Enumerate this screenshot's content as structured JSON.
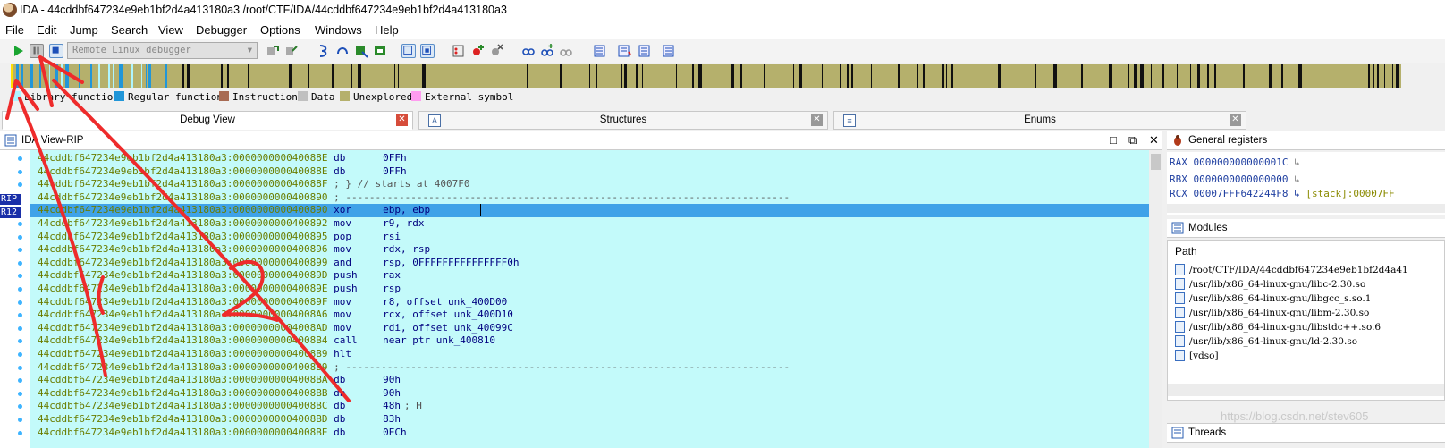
{
  "window": {
    "title": "IDA - 44cddbf647234e9eb1bf2d4a413180a3 /root/CTF/IDA/44cddbf647234e9eb1bf2d4a413180a3"
  },
  "menu": [
    "File",
    "Edit",
    "Jump",
    "Search",
    "View",
    "Debugger",
    "Options",
    "Windows",
    "Help"
  ],
  "toolbar": {
    "debugger_select": "Remote Linux debugger",
    "icons": [
      "start-process-icon",
      "pause-process-icon",
      "terminate-process-icon"
    ]
  },
  "legend": [
    {
      "label": "Library function",
      "color": "#aef5ff"
    },
    {
      "label": "Regular function",
      "color": "#2196d8"
    },
    {
      "label": "Instruction",
      "color": "#a86b53"
    },
    {
      "label": "Data",
      "color": "#c0c0c0"
    },
    {
      "label": "Unexplored",
      "color": "#b5b06c"
    },
    {
      "label": "External symbol",
      "color": "#ff9cf0"
    }
  ],
  "tabs": [
    {
      "label": "Debug View",
      "active": true
    },
    {
      "label": "Structures",
      "active": false
    },
    {
      "label": "Enums",
      "active": false
    }
  ],
  "ida_view": {
    "title": "IDA View-RIP",
    "reg_labels": [
      "RIP",
      "R12"
    ],
    "lines": [
      {
        "addr": "44cddbf647234e9eb1bf2d4a413180a3:000000000040088E",
        "mnem": "db",
        "ops": "0FFh",
        "comment": ""
      },
      {
        "addr": "44cddbf647234e9eb1bf2d4a413180a3:000000000040088E",
        "mnem": "db",
        "ops": "0FFh",
        "comment": ""
      },
      {
        "addr": "44cddbf647234e9eb1bf2d4a413180a3:000000000040088F",
        "mnem": "",
        "ops": "",
        "comment": "; } // starts at 4007F0"
      },
      {
        "addr": "44cddbf647234e9eb1bf2d4a413180a3:0000000000400890",
        "mnem": "",
        "ops": "",
        "comment": "; ---------------------------------------------------------------------------"
      },
      {
        "addr": "44cddbf647234e9eb1bf2d4a413180a3:0000000000400890",
        "mnem": "xor",
        "ops": "ebp, ebp",
        "comment": ""
      },
      {
        "addr": "44cddbf647234e9eb1bf2d4a413180a3:0000000000400892",
        "mnem": "mov",
        "ops": "r9, rdx",
        "comment": ""
      },
      {
        "addr": "44cddbf647234e9eb1bf2d4a413180a3:0000000000400895",
        "mnem": "pop",
        "ops": "rsi",
        "comment": ""
      },
      {
        "addr": "44cddbf647234e9eb1bf2d4a413180a3:0000000000400896",
        "mnem": "mov",
        "ops": "rdx, rsp",
        "comment": ""
      },
      {
        "addr": "44cddbf647234e9eb1bf2d4a413180a3:0000000000400899",
        "mnem": "and",
        "ops": "rsp, 0FFFFFFFFFFFFFFF0h",
        "comment": ""
      },
      {
        "addr": "44cddbf647234e9eb1bf2d4a413180a3:000000000040089D",
        "mnem": "push",
        "ops": "rax",
        "comment": ""
      },
      {
        "addr": "44cddbf647234e9eb1bf2d4a413180a3:000000000040089E",
        "mnem": "push",
        "ops": "rsp",
        "comment": ""
      },
      {
        "addr": "44cddbf647234e9eb1bf2d4a413180a3:000000000040089F",
        "mnem": "mov",
        "ops": "r8, offset unk_400D00",
        "comment": ""
      },
      {
        "addr": "44cddbf647234e9eb1bf2d4a413180a3:00000000004008A6",
        "mnem": "mov",
        "ops": "rcx, offset unk_400D10",
        "comment": ""
      },
      {
        "addr": "44cddbf647234e9eb1bf2d4a413180a3:00000000004008AD",
        "mnem": "mov",
        "ops": "rdi, offset unk_40099C",
        "comment": ""
      },
      {
        "addr": "44cddbf647234e9eb1bf2d4a413180a3:00000000004008B4",
        "mnem": "call",
        "ops": "near ptr unk_400810",
        "comment": ""
      },
      {
        "addr": "44cddbf647234e9eb1bf2d4a413180a3:00000000004008B9",
        "mnem": "hlt",
        "ops": "",
        "comment": ""
      },
      {
        "addr": "44cddbf647234e9eb1bf2d4a413180a3:00000000004008B9",
        "mnem": "",
        "ops": "",
        "comment": "; ---------------------------------------------------------------------------"
      },
      {
        "addr": "44cddbf647234e9eb1bf2d4a413180a3:00000000004008BA",
        "mnem": "db",
        "ops": "90h",
        "comment": ""
      },
      {
        "addr": "44cddbf647234e9eb1bf2d4a413180a3:00000000004008BB",
        "mnem": "db",
        "ops": "90h",
        "comment": ""
      },
      {
        "addr": "44cddbf647234e9eb1bf2d4a413180a3:00000000004008BC",
        "mnem": "db",
        "ops": "48h",
        "comment": "; H"
      },
      {
        "addr": "44cddbf647234e9eb1bf2d4a413180a3:00000000004008BD",
        "mnem": "db",
        "ops": "83h",
        "comment": ""
      },
      {
        "addr": "44cddbf647234e9eb1bf2d4a413180a3:00000000004008BE",
        "mnem": "db",
        "ops": "0ECh",
        "comment": ""
      }
    ]
  },
  "registers": {
    "title": "General registers",
    "items": [
      {
        "name": "RAX",
        "value": "000000000000001C",
        "note": ""
      },
      {
        "name": "RBX",
        "value": "0000000000000000",
        "note": ""
      },
      {
        "name": "RCX",
        "value": "00007FFF642244F8",
        "note": "[stack]:00007FF"
      }
    ]
  },
  "modules": {
    "title": "Modules",
    "column": "Path",
    "items": [
      "/root/CTF/IDA/44cddbf647234e9eb1bf2d4a41",
      "/usr/lib/x86_64-linux-gnu/libc-2.30.so",
      "/usr/lib/x86_64-linux-gnu/libgcc_s.so.1",
      "/usr/lib/x86_64-linux-gnu/libm-2.30.so",
      "/usr/lib/x86_64-linux-gnu/libstdc++.so.6",
      "/usr/lib/x86_64-linux-gnu/ld-2.30.so",
      "[vdso]"
    ]
  },
  "threads": {
    "title": "Threads"
  },
  "annotation": {
    "number": "2"
  },
  "watermark": "https://blog.csdn.net/stev605"
}
